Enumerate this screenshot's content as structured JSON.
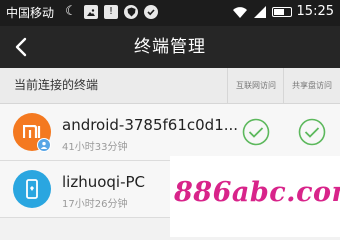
{
  "status_bar": {
    "carrier": "中国移动",
    "time": "15:25",
    "icons": [
      "moon-icon",
      "image-icon",
      "notification-icon",
      "shield-icon",
      "check-icon"
    ]
  },
  "header": {
    "title": "终端管理"
  },
  "table": {
    "section_title": "当前连接的终端",
    "columns": [
      "互联网访问",
      "共享盘访问"
    ]
  },
  "devices": [
    {
      "name": "android-3785f61c0d1...",
      "time": "41小时33分钟",
      "icon": "mi-logo",
      "internet_access": true,
      "shared_disk_access": true
    },
    {
      "name": "lizhuoqi-PC",
      "time": "17小时26分钟",
      "icon": "phone-icon"
    }
  ],
  "watermark": {
    "text": "886abc.com",
    "color": "#d8248a"
  },
  "colors": {
    "status_bar": "#1c1c1c",
    "title_bar": "#262626",
    "check_green": "#5cb85c",
    "mi_orange": "#f47920",
    "phone_blue": "#2aa6e0"
  }
}
